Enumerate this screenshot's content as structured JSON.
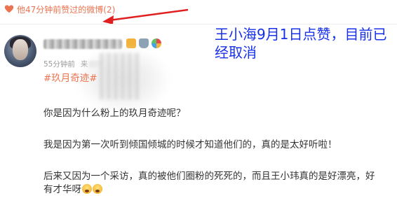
{
  "liked_bar": {
    "text": "他47分钟前赞过的微博(2)",
    "icon": "heart-icon",
    "color": "#eb7350"
  },
  "post": {
    "meta": {
      "time": "55分钟前",
      "source_prefix": "来"
    },
    "hashtag": "#玖月奇迹#",
    "lines": [
      "你是因为什么粉上的玖月奇迹呢？",
      "我是因为第一次听到倾国倾城的时候才知道他们的，真的是太好听啦！",
      "后来又因为一个采访，真的被他们圈粉的死死的，而且王小玮真的是好漂亮，好",
      "有才华呀"
    ],
    "emoji_icons": [
      "shocked-face-icon",
      "shocked-face-icon"
    ]
  },
  "annotation": {
    "text": "王小海9月1日点赞，目前已经取消",
    "color": "#1730e8"
  },
  "arrow_color": "#e02020"
}
